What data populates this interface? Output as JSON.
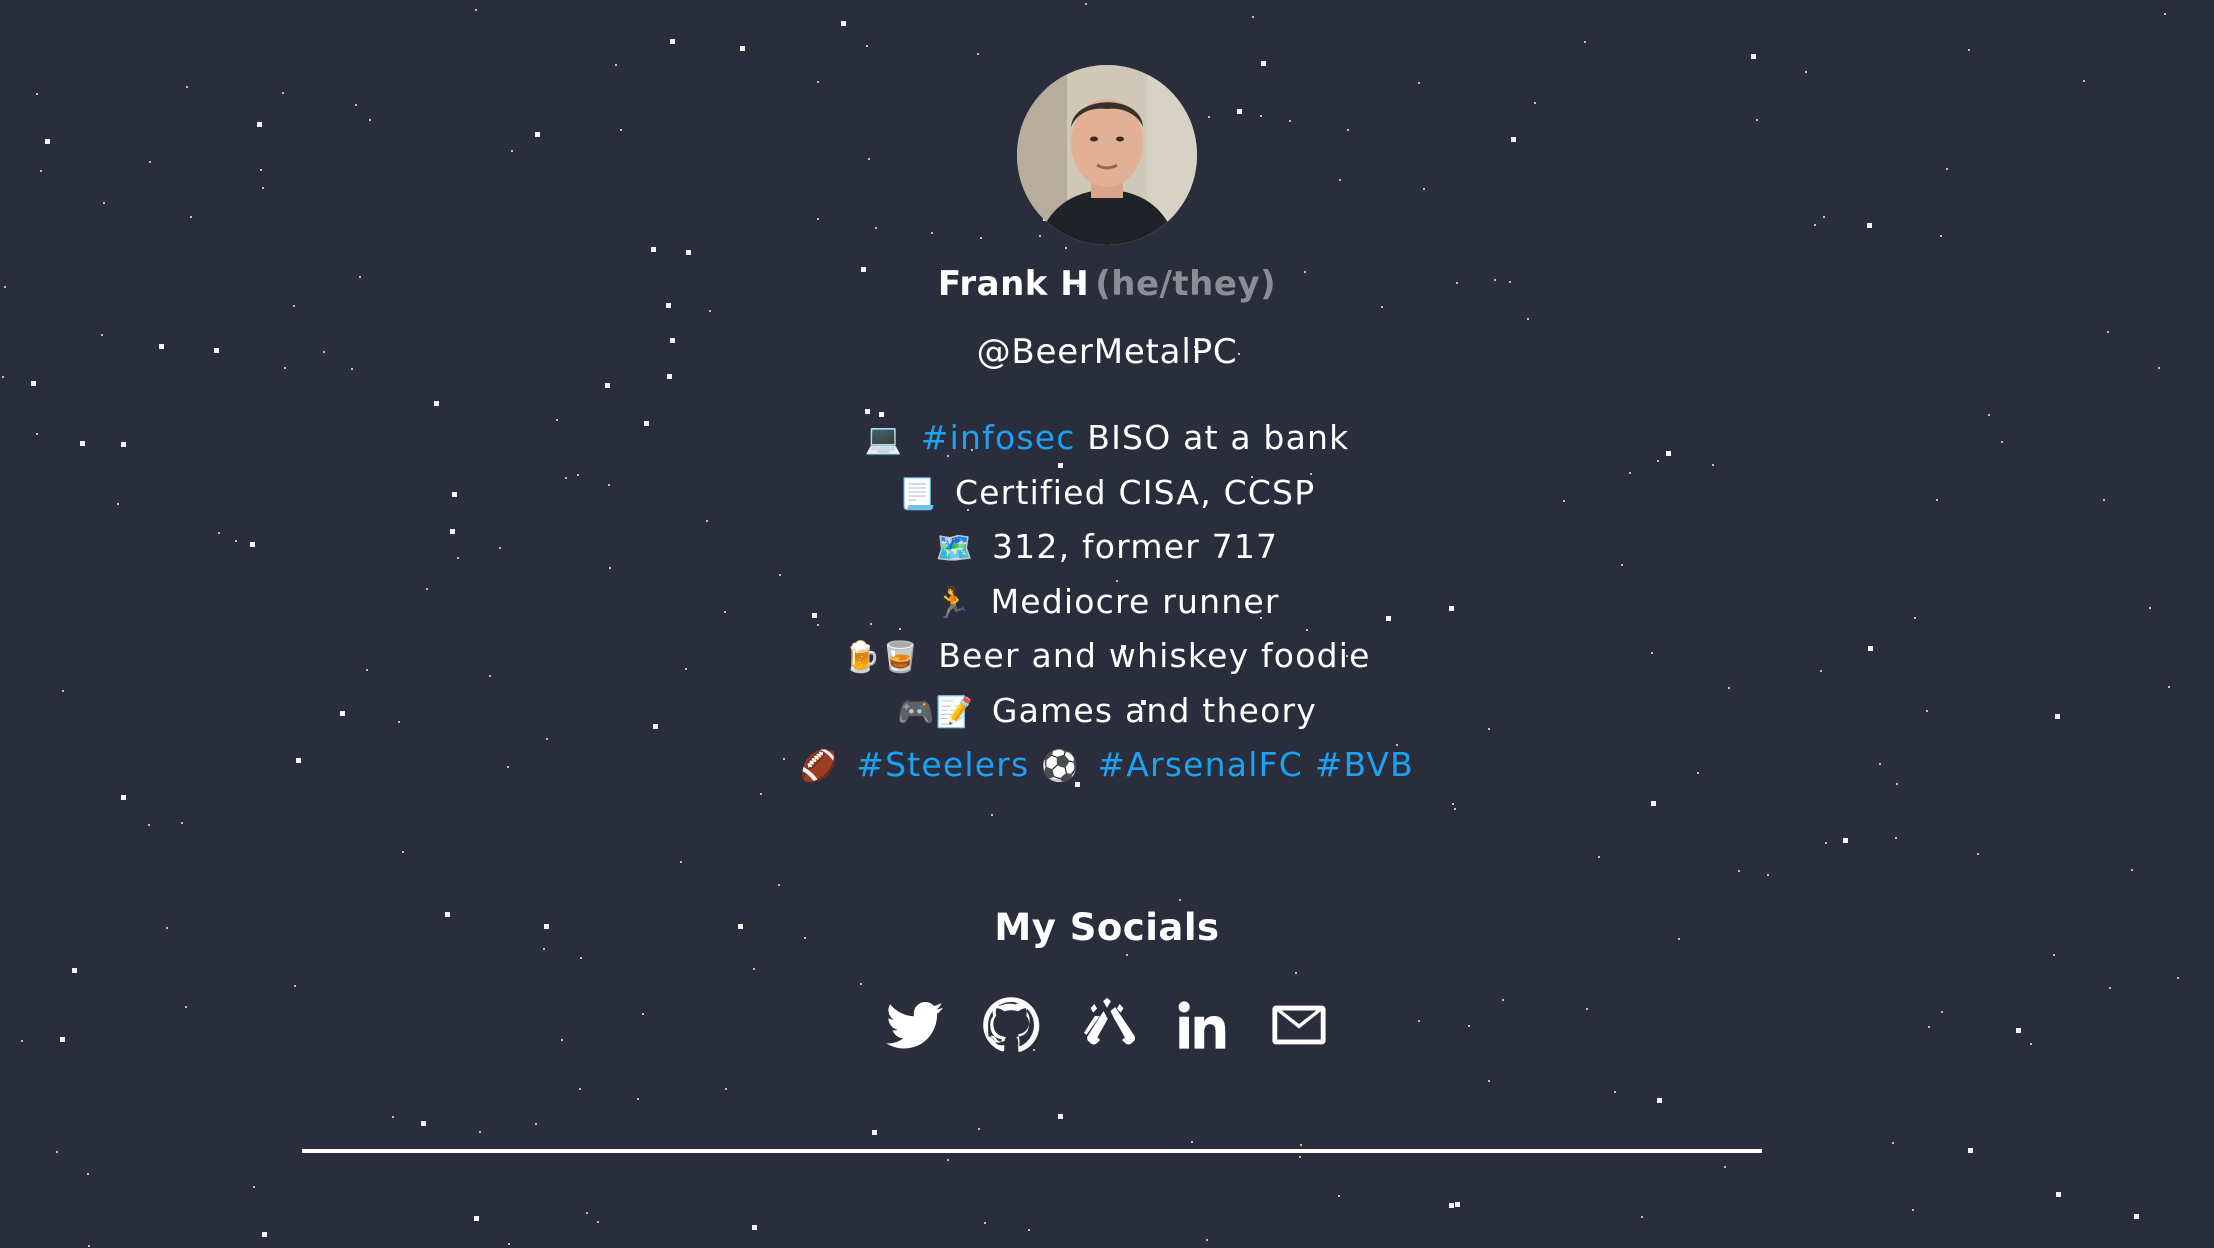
{
  "profile": {
    "avatar_alt": "Frank H profile photo",
    "name": "Frank H",
    "pronouns": "(he/they)",
    "handle": "@BeerMetalPC"
  },
  "bio": {
    "line1": {
      "emoji": "💻",
      "tag": "#infosec",
      "text": "BISO at a bank"
    },
    "line2": {
      "emoji": "📃",
      "text": "Certified CISA, CCSP"
    },
    "line3": {
      "emoji": "🗺️",
      "text": "312, former 717"
    },
    "line4": {
      "emoji": "🏃",
      "text": "Mediocre runner"
    },
    "line5": {
      "emoji": "🍺🥃",
      "text": "Beer and whiskey foodie"
    },
    "line6": {
      "emoji": "🎮📝",
      "text": "Games and theory"
    },
    "line7": {
      "emoji1": "🏈",
      "tag1": "#Steelers",
      "emoji2": "⚽",
      "tag2": "#ArsenalFC",
      "tag3": "#BVB"
    }
  },
  "socials": {
    "heading": "My Socials",
    "items": [
      {
        "icon": "twitter-icon",
        "label": "Twitter"
      },
      {
        "icon": "github-icon",
        "label": "GitHub"
      },
      {
        "icon": "untappd-icon",
        "label": "Untappd"
      },
      {
        "icon": "linkedin-icon",
        "label": "LinkedIn"
      },
      {
        "icon": "email-icon",
        "label": "Email"
      }
    ]
  },
  "colors": {
    "background": "#2a2e3c",
    "text": "#ffffff",
    "link": "#1da1f2",
    "pronouns": "#8a8d96"
  }
}
